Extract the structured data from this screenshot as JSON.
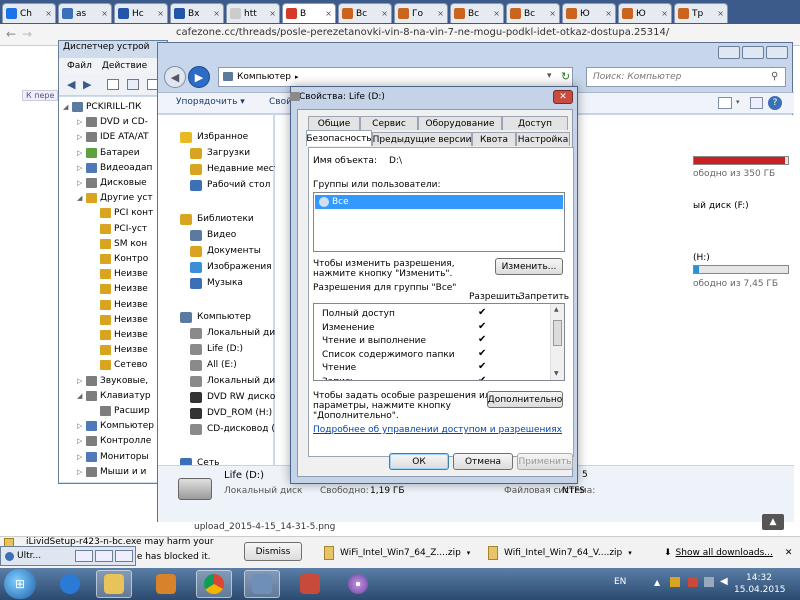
{
  "browser": {
    "tabs": [
      {
        "label": "Ch",
        "color": "#1a73e8"
      },
      {
        "label": "as",
        "color": "#3b6fb6"
      },
      {
        "label": "Нс",
        "color": "#2356a8"
      },
      {
        "label": "Вх",
        "color": "#2356a8"
      },
      {
        "label": "htt",
        "color": "#cccccc"
      },
      {
        "label": "В",
        "color": "#d23a2a"
      },
      {
        "label": "Вс",
        "color": "#c9651f"
      },
      {
        "label": "Го",
        "color": "#c9651f"
      },
      {
        "label": "Вс",
        "color": "#c9651f"
      },
      {
        "label": "Вс",
        "color": "#c9651f"
      },
      {
        "label": "Ю",
        "color": "#c9651f"
      },
      {
        "label": "Ю",
        "color": "#c9651f"
      },
      {
        "label": "Тр",
        "color": "#c9651f"
      }
    ],
    "url": "cafezone.cc/threads/posle-perezetanovki-vin-8-na-vin-7-ne-mogu-podkl-idet-otkaz-dostupa.25314/",
    "page_button": "К пере"
  },
  "devmgr": {
    "title": "Диспетчер устрой",
    "menu": [
      "Файл",
      "Действие"
    ],
    "tree": [
      {
        "label": "PCKIRILL-ПК",
        "depth": 0,
        "arrow": "◢",
        "color": "#5a7aa0"
      },
      {
        "label": "DVD и CD-",
        "depth": 1,
        "arrow": "▷",
        "color": "#7d7d7d"
      },
      {
        "label": "IDE ATA/AT",
        "depth": 1,
        "arrow": "▷",
        "color": "#7d7d7d"
      },
      {
        "label": "Батареи",
        "depth": 1,
        "arrow": "▷",
        "color": "#5da13e"
      },
      {
        "label": "Видеоадап",
        "depth": 1,
        "arrow": "▷",
        "color": "#4f79b8"
      },
      {
        "label": "Дисковые",
        "depth": 1,
        "arrow": "▷",
        "color": "#7d7d7d"
      },
      {
        "label": "Другие уст",
        "depth": 1,
        "arrow": "◢",
        "color": "#d9a520"
      },
      {
        "label": "PCI конт",
        "depth": 2,
        "arrow": "",
        "color": "#d9a520"
      },
      {
        "label": "PCI-уст",
        "depth": 2,
        "arrow": "",
        "color": "#d9a520"
      },
      {
        "label": "SM кон",
        "depth": 2,
        "arrow": "",
        "color": "#d9a520"
      },
      {
        "label": "Контро",
        "depth": 2,
        "arrow": "",
        "color": "#d9a520"
      },
      {
        "label": "Неизве",
        "depth": 2,
        "arrow": "",
        "color": "#d9a520"
      },
      {
        "label": "Неизве",
        "depth": 2,
        "arrow": "",
        "color": "#d9a520"
      },
      {
        "label": "Неизве",
        "depth": 2,
        "arrow": "",
        "color": "#d9a520"
      },
      {
        "label": "Неизве",
        "depth": 2,
        "arrow": "",
        "color": "#d9a520"
      },
      {
        "label": "Неизве",
        "depth": 2,
        "arrow": "",
        "color": "#d9a520"
      },
      {
        "label": "Неизве",
        "depth": 2,
        "arrow": "",
        "color": "#d9a520"
      },
      {
        "label": "Сетево",
        "depth": 2,
        "arrow": "",
        "color": "#d9a520"
      },
      {
        "label": "Звуковые,",
        "depth": 1,
        "arrow": "▷",
        "color": "#7d7d7d"
      },
      {
        "label": "Клавиатур",
        "depth": 1,
        "arrow": "◢",
        "color": "#7d7d7d"
      },
      {
        "label": "Расшир",
        "depth": 2,
        "arrow": "",
        "color": "#7d7d7d"
      },
      {
        "label": "Компьютер",
        "depth": 1,
        "arrow": "▷",
        "color": "#4f79b8"
      },
      {
        "label": "Контролле",
        "depth": 1,
        "arrow": "▷",
        "color": "#7d7d7d"
      },
      {
        "label": "Мониторы",
        "depth": 1,
        "arrow": "▷",
        "color": "#4f79b8"
      },
      {
        "label": "Мыши и и",
        "depth": 1,
        "arrow": "▷",
        "color": "#7d7d7d"
      }
    ]
  },
  "explorer": {
    "path_label": "Компьютер",
    "search_placeholder": "Поиск: Компьютер",
    "organize_label": "Упорядочить ▾",
    "toolbar_partial": "Свой",
    "nav": [
      {
        "label": "Избранное",
        "icon": "star-icon",
        "color": "#e8b923",
        "indent": 0
      },
      {
        "label": "Загрузки",
        "icon": "downloads-folder-icon",
        "color": "#d9a520",
        "indent": 1
      },
      {
        "label": "Недавние места",
        "icon": "recent-places-icon",
        "color": "#d9a520",
        "indent": 1
      },
      {
        "label": "Рабочий стол",
        "icon": "desktop-icon",
        "color": "#3b6fb6",
        "indent": 1
      },
      {
        "label": "Библиотеки",
        "icon": "libraries-icon",
        "color": "#d9a520",
        "indent": 0
      },
      {
        "label": "Видео",
        "icon": "video-icon",
        "color": "#5a7aa0",
        "indent": 1
      },
      {
        "label": "Документы",
        "icon": "documents-icon",
        "color": "#d9a520",
        "indent": 1
      },
      {
        "label": "Изображения",
        "icon": "pictures-icon",
        "color": "#3b8fd9",
        "indent": 1
      },
      {
        "label": "Музыка",
        "icon": "music-icon",
        "color": "#3b6fb6",
        "indent": 1
      },
      {
        "label": "Компьютер",
        "icon": "computer-icon",
        "color": "#5a7aa0",
        "indent": 0
      },
      {
        "label": "Локальный диск",
        "icon": "local-disk-icon",
        "color": "#8a8a8a",
        "indent": 1
      },
      {
        "label": "Life (D:)",
        "icon": "drive-icon",
        "color": "#8a8a8a",
        "indent": 1
      },
      {
        "label": "All (E:)",
        "icon": "drive-icon",
        "color": "#8a8a8a",
        "indent": 1
      },
      {
        "label": "Локальный диск",
        "icon": "local-disk-icon",
        "color": "#8a8a8a",
        "indent": 1
      },
      {
        "label": "DVD RW дисково",
        "icon": "dvd-icon",
        "color": "#333333",
        "indent": 1
      },
      {
        "label": "DVD_ROM (H:)",
        "icon": "dvd-icon",
        "color": "#333333",
        "indent": 1
      },
      {
        "label": "CD-дисковод (I:)",
        "icon": "cd-icon",
        "color": "#8a8a8a",
        "indent": 1
      },
      {
        "label": "Сеть",
        "icon": "network-icon",
        "color": "#3b6fb6",
        "indent": 0
      }
    ],
    "content": {
      "c_free": "ободно из 350 ГБ",
      "c_fill": 0.97,
      "f_label": "ый диск (F:)",
      "h_label": "(H:)",
      "h_free": "ободно из 7,45 ГБ",
      "h_fill": 0.05
    },
    "details": {
      "name": "Life (D:)",
      "type": "Локальный диск",
      "free_label": "Свободно:",
      "free_value": "1,19 ГБ",
      "fs_label": "Файловая система:",
      "fs_value": "NTFS",
      "partial": "5"
    }
  },
  "dialog": {
    "title": "Свойства: Life (D:)",
    "tabs_row1": [
      "Общие",
      "Сервис",
      "Оборудование",
      "Доступ"
    ],
    "tabs_row2": [
      "Безопасность",
      "Предыдущие версии",
      "Квота",
      "Настройка"
    ],
    "object_label": "Имя объекта:",
    "object_value": "D:\\",
    "groups_label": "Группы или пользователи:",
    "group_item": "Все",
    "change_hint_1": "Чтобы изменить разрешения,",
    "change_hint_2": "нажмите кнопку \"Изменить\".",
    "change_btn": "Изменить...",
    "perm_for": "Разрешения для группы \"Все\"",
    "allow": "Разрешить",
    "deny": "Запретить",
    "permissions": [
      {
        "label": "Полный доступ",
        "allow": "✔"
      },
      {
        "label": "Изменение",
        "allow": "✔"
      },
      {
        "label": "Чтение и выполнение",
        "allow": "✔"
      },
      {
        "label": "Список содержимого папки",
        "allow": "✔"
      },
      {
        "label": "Чтение",
        "allow": "✔"
      },
      {
        "label": "Запись",
        "allow": "✔"
      }
    ],
    "special_1": "Чтобы задать особые разрешения или",
    "special_2": "параметры, нажмите кнопку",
    "special_3": "\"Дополнительно\".",
    "advanced_btn": "Дополнительно",
    "link": "Подробнее об управлении доступом и разрешениях",
    "ok": "ОК",
    "cancel": "Отмена",
    "apply": "Применить"
  },
  "page_below": {
    "upload_file": "upload_2015-4-15_14-31-5.png"
  },
  "downloads": {
    "warning_1": "iLividSetup-r423-n-bc.exe may harm your",
    "warning_2": "so Chrome has blocked it.",
    "dismiss": "Dismiss",
    "item1": "WiFi_Intel_Win7_64_Z....zip",
    "item2": "Wifi_Intel_Win7_64_V....zip",
    "show_all": "Show all downloads...",
    "ultr": "Ultr..."
  },
  "taskbar": {
    "lang": "EN",
    "time": "14:32",
    "date": "15.04.2015"
  }
}
